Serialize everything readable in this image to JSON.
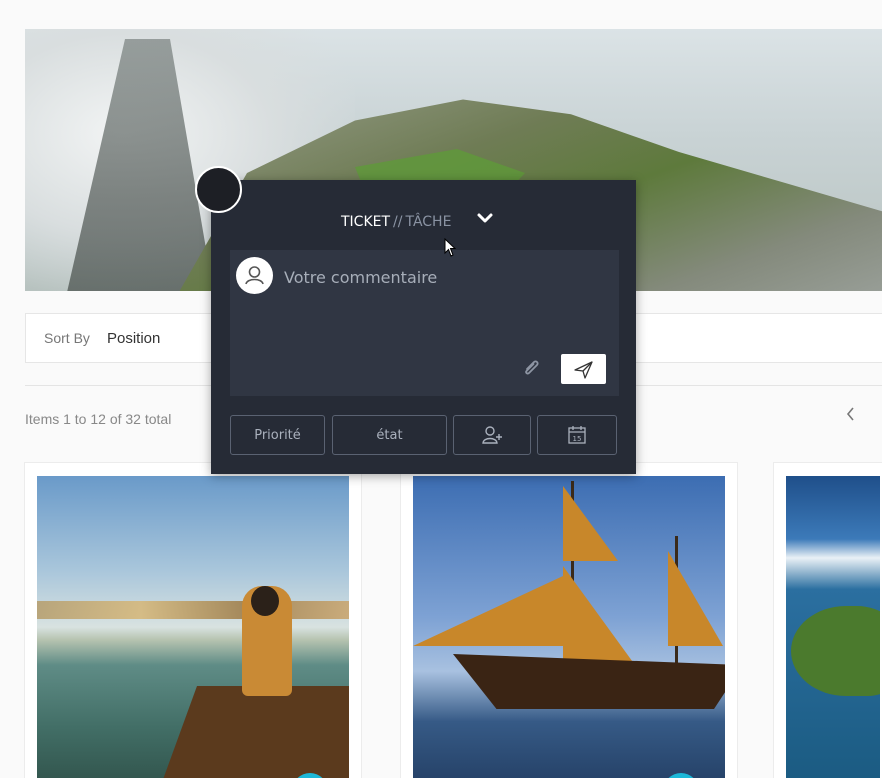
{
  "toolbar": {
    "sort_by_label": "Sort By",
    "sort_value": "Position",
    "items_total": "Items 1 to 12 of 32 total",
    "prev_icon": "chevron-left-icon"
  },
  "popup": {
    "tab_active": "TICKET",
    "tab_separator": "//",
    "tab_inactive": "TÂCHE",
    "comment_placeholder": "Votre commentaire",
    "buttons": {
      "priorite": "Priorité",
      "etat": "état",
      "assign_icon": "add-user-icon",
      "date_icon": "calendar-icon",
      "date_number": "15"
    },
    "attach_icon": "paperclip-icon",
    "send_icon": "send-icon"
  },
  "colors": {
    "popup_bg": "#262b36",
    "comment_bg": "#303643",
    "badge": "#1cb8d8"
  }
}
